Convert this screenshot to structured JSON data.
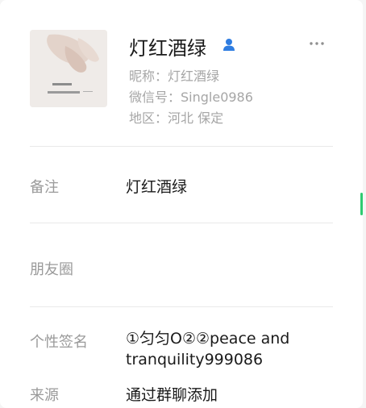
{
  "profile": {
    "name": "灯红酒绿",
    "nickname": "昵称：灯红酒绿",
    "wechat_id": "微信号：Single0986",
    "region": "地区：河北 保定",
    "gender_icon": "male-user-icon",
    "more_icon": "more-dots-icon"
  },
  "details": {
    "remark_label": "备注",
    "remark_value": "灯红酒绿",
    "moments_label": "朋友圈",
    "signature_label": "个性签名",
    "signature_value": "①匀匀O②②peace and tranquility999086",
    "source_label": "来源",
    "source_value": "通过群聊添加"
  },
  "colors": {
    "accent_blue": "#2f7de1",
    "accent_green": "#2ecc71",
    "label_gray": "#9a9a9a",
    "meta_gray": "#a6a6a6"
  }
}
